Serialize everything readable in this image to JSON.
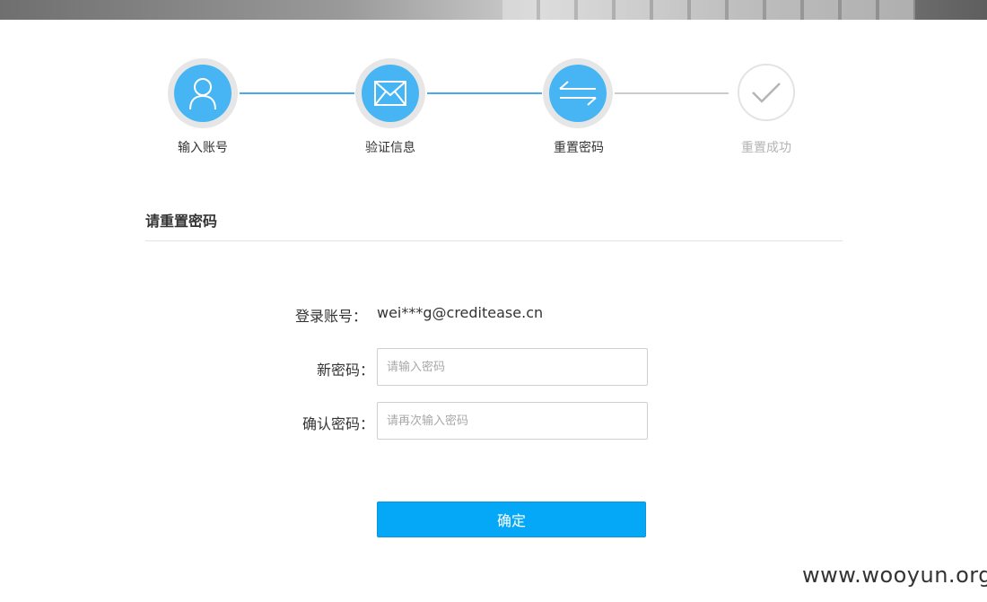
{
  "steps": [
    {
      "label": "输入账号",
      "icon": "user-icon",
      "state": "completed"
    },
    {
      "label": "验证信息",
      "icon": "envelope-icon",
      "state": "completed"
    },
    {
      "label": "重置密码",
      "icon": "exchange-icon",
      "state": "current"
    },
    {
      "label": "重置成功",
      "icon": "check-icon",
      "state": "pending"
    }
  ],
  "section": {
    "title": "请重置密码"
  },
  "form": {
    "account_label": "登录账号：",
    "account_value": "wei***g@creditease.cn",
    "new_password_label": "新密码：",
    "new_password_placeholder": "请输入密码",
    "confirm_password_label": "确认密码：",
    "confirm_password_placeholder": "请再次输入密码",
    "submit_label": "确定"
  },
  "watermark": "www.wooyun.org",
  "colors": {
    "accent": "#47b5f3",
    "button": "#05a8f6",
    "line_active": "#4aa8ea",
    "line_inactive": "#cccccc"
  }
}
